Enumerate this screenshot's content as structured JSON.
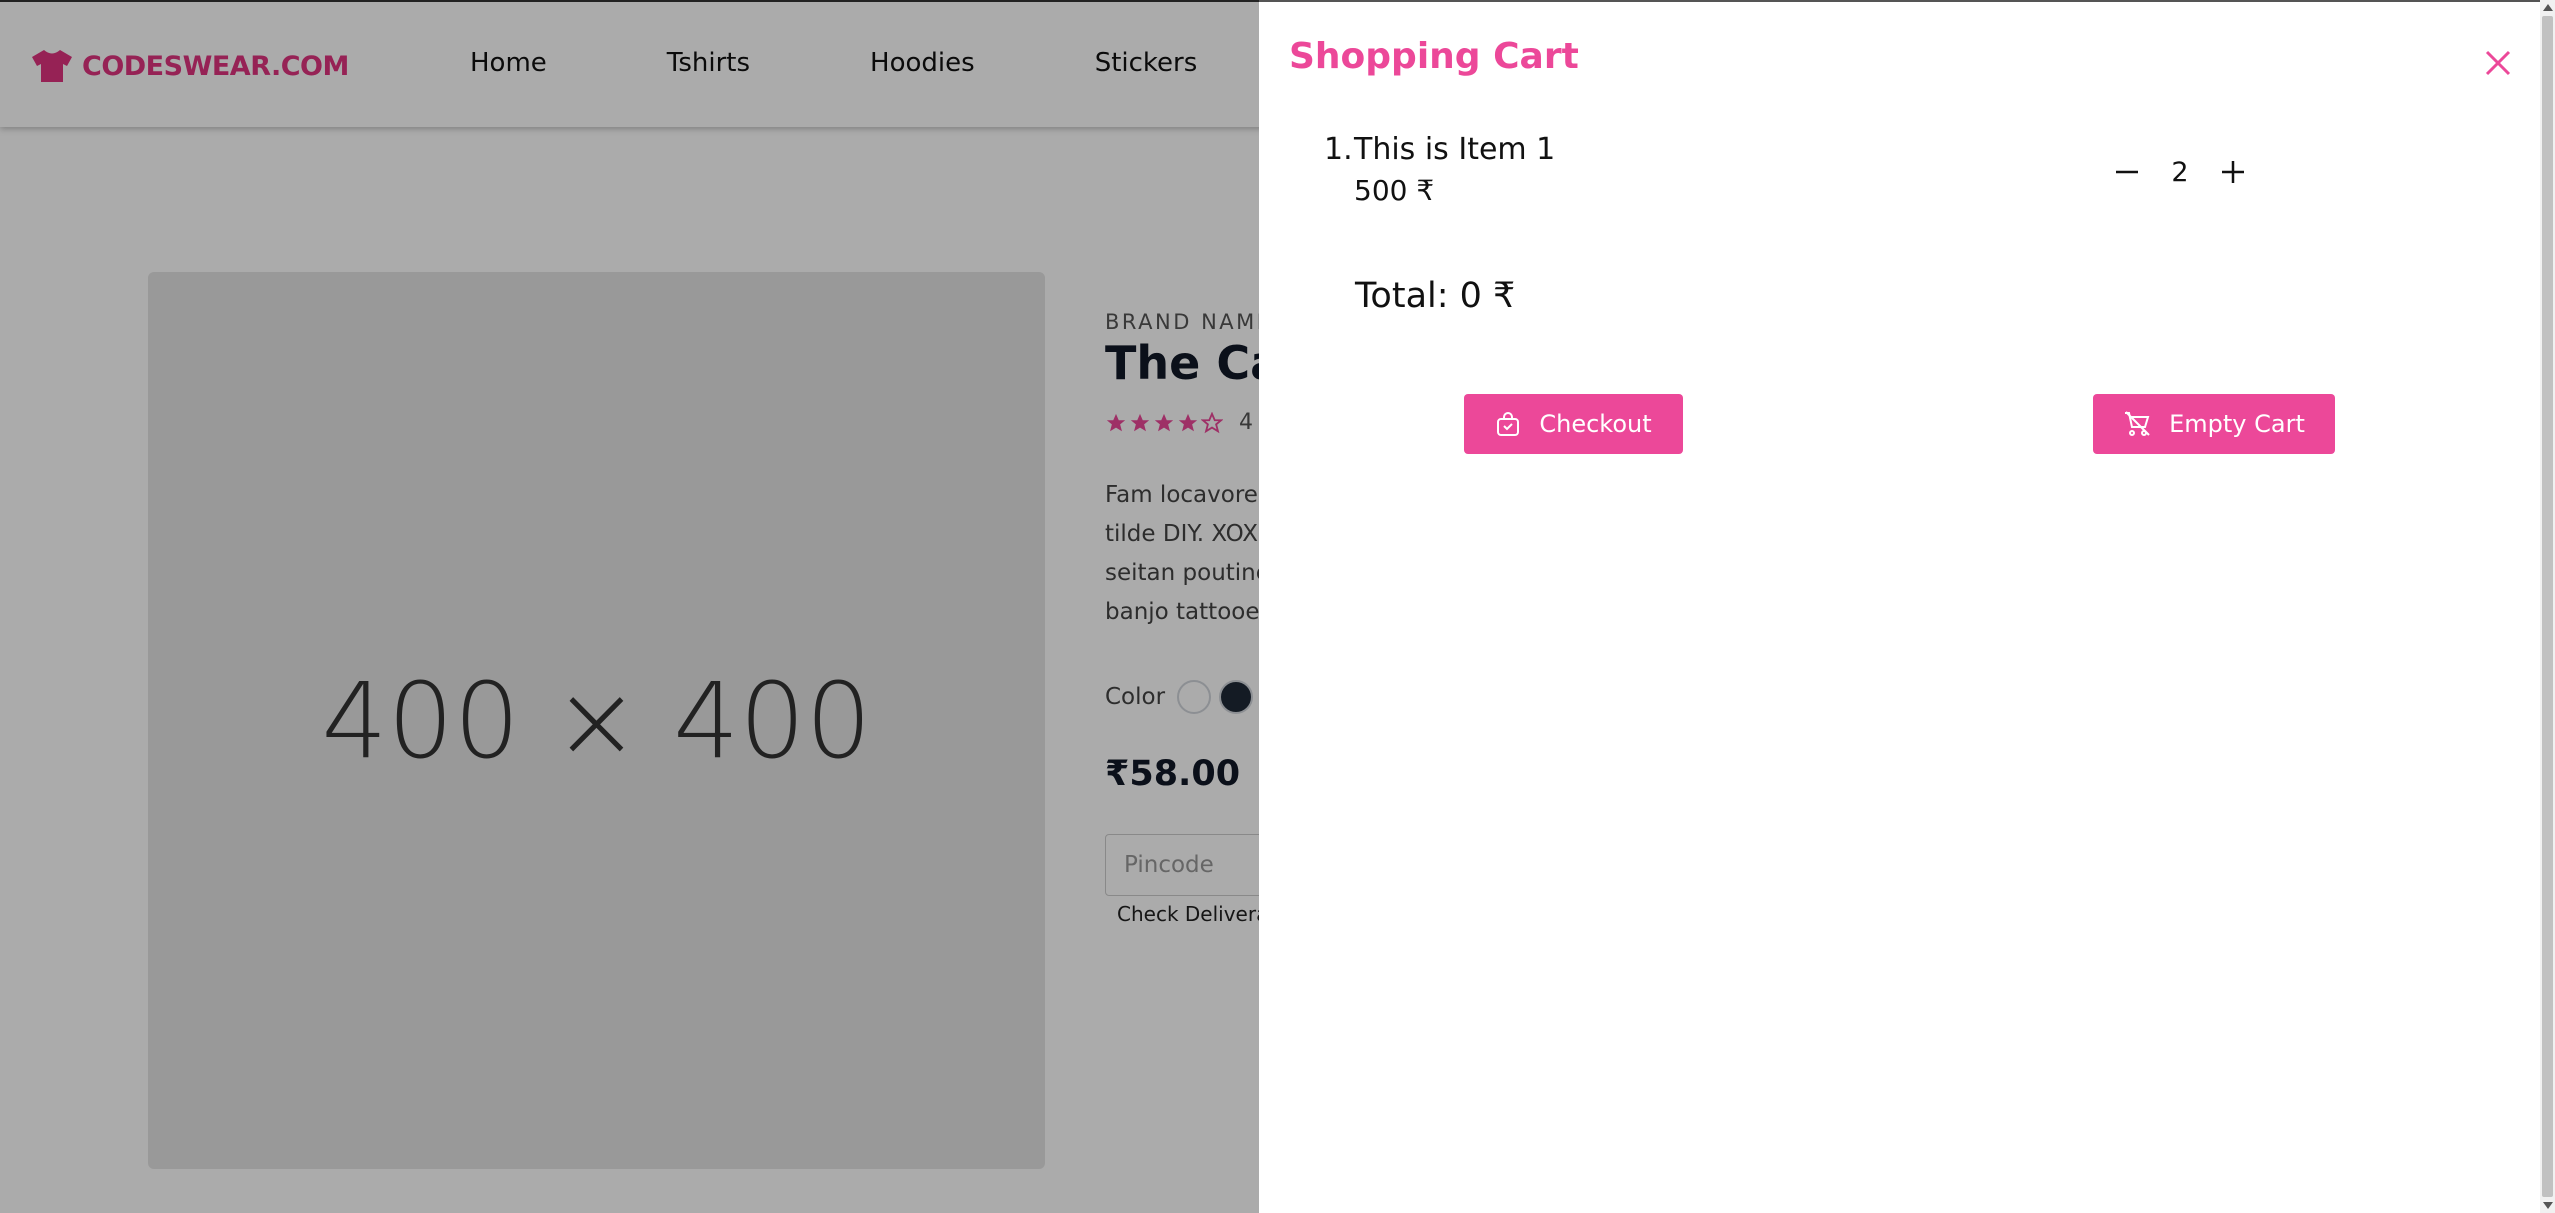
{
  "navbar": {
    "logo_text": "CODESWEAR.COM",
    "links": [
      "Home",
      "Tshirts",
      "Hoodies",
      "Stickers"
    ]
  },
  "product": {
    "image_placeholder": "400 × 400",
    "brand": "BRAND NAME",
    "title": "The Cat",
    "rating": 4,
    "reviews": "4",
    "description_lines": [
      "Fam locavore k",
      "tilde DIY. XOX",
      "seitan poutine",
      "banjo tattooed"
    ],
    "color_label": "Color",
    "colors": [
      "#ffffff",
      "#1f2937"
    ],
    "price": "₹58.00",
    "pincode_placeholder": "Pincode",
    "check_delivery": "Check Delivera"
  },
  "cart": {
    "title": "Shopping Cart",
    "items": [
      {
        "number": "1.",
        "name": "This is Item 1",
        "price": "500 ₹",
        "qty": "2"
      }
    ],
    "total": "Total: 0 ₹",
    "checkout_label": "Checkout",
    "empty_label": "Empty Cart"
  },
  "colors": {
    "accent": "#ec4899",
    "overlay": "rgba(0,0,0,0.33)"
  },
  "icons": [
    "tshirt-icon",
    "close-icon",
    "minus-icon",
    "plus-icon",
    "shopping-bag-icon",
    "cart-off-icon",
    "star-icon"
  ]
}
